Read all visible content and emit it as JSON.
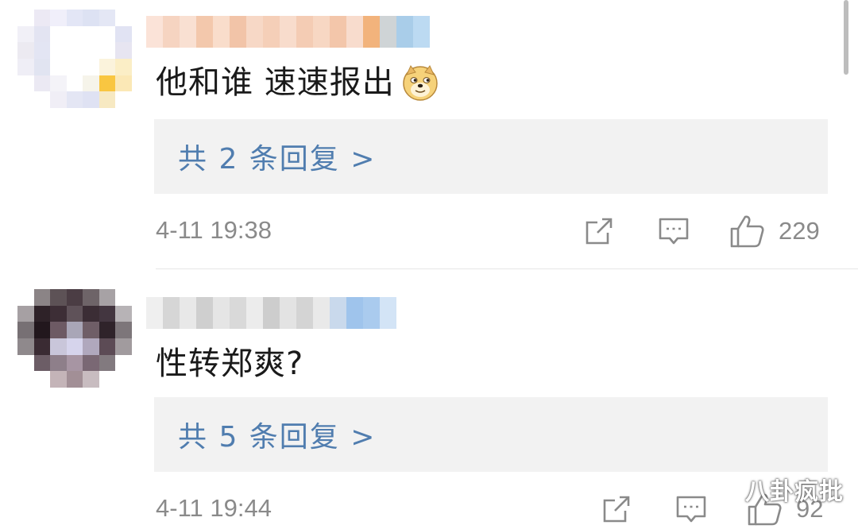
{
  "comments": [
    {
      "text": "他和谁 速速报出",
      "emoji": "doge-emoji-icon",
      "replies_label": "共 2 条回复 >",
      "timestamp": "4-11 19:38",
      "like_count": "229"
    },
    {
      "text": "性转郑爽?",
      "replies_label": "共 5 条回复 >",
      "timestamp": "4-11 19:44",
      "like_count": "92"
    }
  ],
  "watermark": "八卦疯批",
  "colors": {
    "reply_link": "#507daf",
    "meta_gray": "#8a8a8a",
    "reply_bg": "#f2f2f2"
  }
}
